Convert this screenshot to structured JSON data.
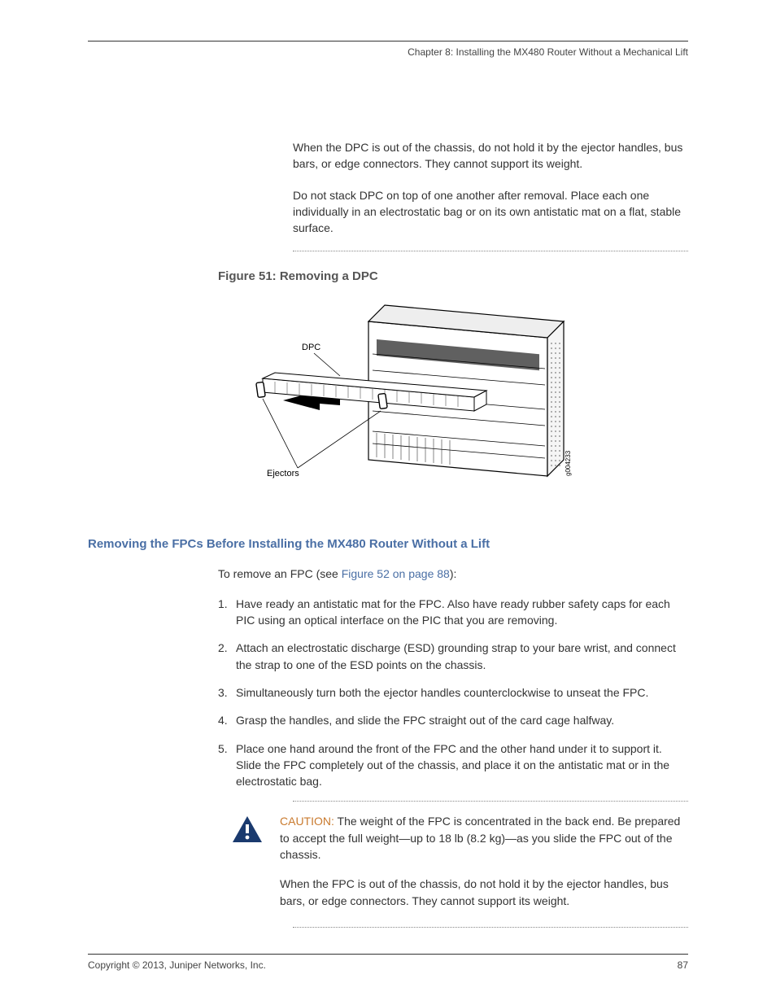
{
  "header": {
    "chapter": "Chapter 8: Installing the MX480 Router Without a Mechanical Lift"
  },
  "paragraphs": {
    "p1": "When the DPC is out of the chassis, do not hold it by the ejector handles, bus bars, or edge connectors. They cannot support its weight.",
    "p2": "Do not stack DPC on top of one another after removal. Place each one individually in an electrostatic bag or on its own antistatic mat on a flat, stable surface."
  },
  "figure": {
    "title": "Figure 51: Removing a DPC",
    "label_dpc": "DPC",
    "label_ejectors": "Ejectors",
    "id": "g004233"
  },
  "section": {
    "heading": "Removing the FPCs Before Installing the MX480 Router Without a Lift",
    "intro_pre": "To remove an FPC (see ",
    "intro_link": "Figure 52 on page 88",
    "intro_post": "):"
  },
  "steps": [
    {
      "num": "1.",
      "text": "Have ready an antistatic mat for the FPC. Also have ready rubber safety caps for each PIC using an optical interface on the PIC that you are removing."
    },
    {
      "num": "2.",
      "text": "Attach an electrostatic discharge (ESD) grounding strap to your bare wrist, and connect the strap to one of the ESD points on the chassis."
    },
    {
      "num": "3.",
      "text": "Simultaneously turn both the ejector handles counterclockwise to unseat the FPC."
    },
    {
      "num": "4.",
      "text": "Grasp the handles, and slide the FPC straight out of the card cage halfway."
    },
    {
      "num": "5.",
      "text": "Place one hand around the front of the FPC and the other hand under it to support it. Slide the FPC completely out of the chassis, and place it on the antistatic mat or in the electrostatic bag."
    }
  ],
  "caution": {
    "label": "CAUTION: ",
    "text1": "The weight of the FPC is concentrated in the back end. Be prepared to accept the full weight—up to 18 lb (8.2 kg)—as you slide the FPC out of the chassis.",
    "text2": "When the FPC is out of the chassis, do not hold it by the ejector handles, bus bars, or edge connectors. They cannot support its weight."
  },
  "footer": {
    "copyright": "Copyright © 2013, Juniper Networks, Inc.",
    "page": "87"
  }
}
